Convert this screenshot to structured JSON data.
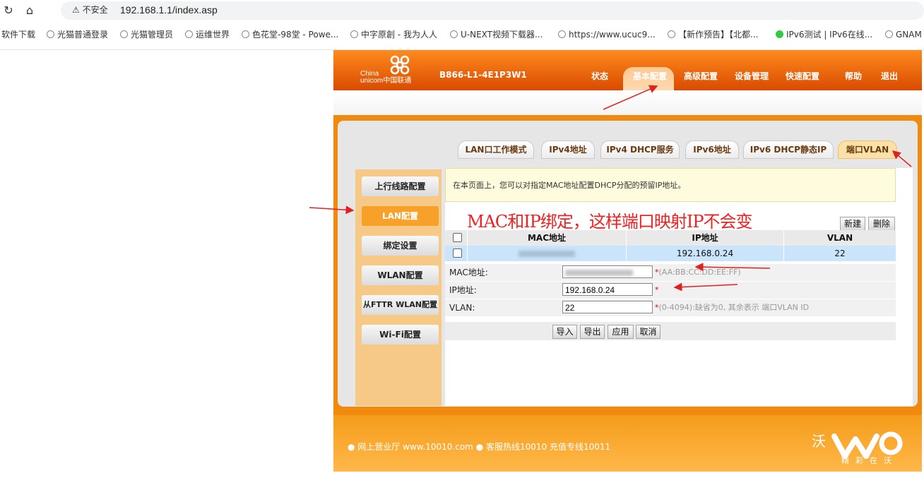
{
  "browser": {
    "security_label": "不安全",
    "url": "192.168.1.1/index.asp",
    "bookmarks": [
      "软件下载",
      "光猫普通登录",
      "光猫管理员",
      "运维世界",
      "色花堂-98堂 - Powe...",
      "中字原創 - 我为人人",
      "U-NEXT视频下载器...",
      "https://www.ucuc9...",
      "【新作预告】【北都...",
      "IPv6测试 | IPv6在线...",
      "GNAM"
    ]
  },
  "router": {
    "logo_text_1": "China",
    "logo_text_2": "unicom中国联通",
    "model": "B866-L1-4E1P3W1",
    "top_nav": [
      "状态",
      "基本配置",
      "高级配置",
      "设备管理",
      "快速配置",
      "帮助",
      "退出"
    ],
    "active_top_nav": "基本配置",
    "tabs": [
      "LAN口工作模式",
      "IPv4地址",
      "IPv4 DHCP服务",
      "IPv6地址",
      "IPv6 DHCP静态IP",
      "端口VLAN"
    ],
    "active_tab": "端口VLAN",
    "sidebar": [
      "上行线路配置",
      "LAN配置",
      "绑定设置",
      "WLAN配置",
      "从FTTR WLAN配置",
      "Wi-Fi配置"
    ],
    "active_sidebar": "LAN配置",
    "description": "在本页面上，您可以对指定MAC地址配置DHCP分配的预留IP地址。",
    "annotation": "MAC和IP绑定，这样端口映射IP不会变",
    "new_button": "新建",
    "delete_button": "删除",
    "table": {
      "headers": [
        "MAC地址",
        "IP地址",
        "VLAN"
      ],
      "rows": [
        {
          "mac": "",
          "ip": "192.168.0.24",
          "vlan": "22"
        }
      ]
    },
    "form": {
      "mac_label": "MAC地址:",
      "mac_value": "",
      "mac_hint": "(AA:BB:CC:DD:EE:FF)",
      "ip_label": "IP地址:",
      "ip_value": "192.168.0.24",
      "vlan_label": "VLAN:",
      "vlan_value": "22",
      "vlan_hint": "(0-4094):缺省为0, 其余表示 端口VLAN ID",
      "required_mark": "*"
    },
    "actions": [
      "导入",
      "导出",
      "应用",
      "取消"
    ],
    "footer": "● 网上营业厅  www.10010.com ● 客服热线10010  充值专线10011",
    "slogan": "精彩在沃",
    "colors": {
      "orange": "#f08a0e",
      "annotation": "#ee2222"
    }
  }
}
